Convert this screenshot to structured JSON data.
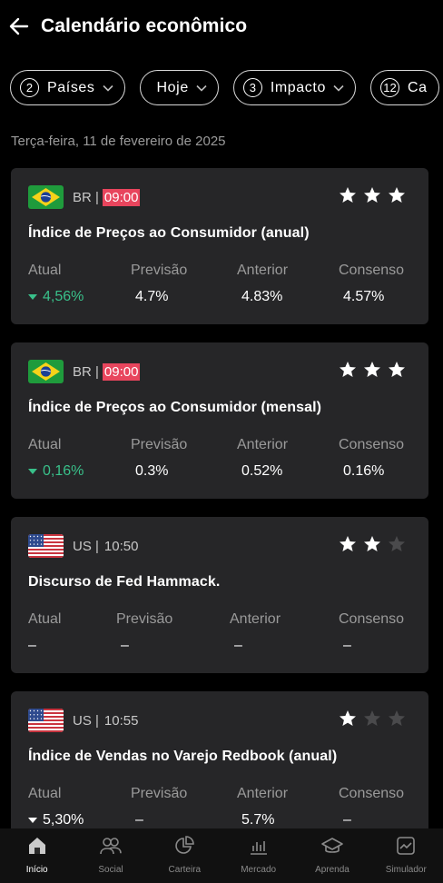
{
  "header": {
    "title": "Calendário econômico"
  },
  "filters": [
    {
      "badge": "2",
      "label": "Países",
      "chevron": true
    },
    {
      "badge": "",
      "label": "Hoje",
      "chevron": true
    },
    {
      "badge": "3",
      "label": "Impacto",
      "chevron": true
    },
    {
      "badge": "12",
      "label": "Ca",
      "chevron": false
    }
  ],
  "date_label": "Terça-feira, 11 de fevereiro de 2025",
  "events": [
    {
      "flag": "br-flag",
      "country": "BR |",
      "time": "09:00",
      "time_highlight": true,
      "stars": 3,
      "title": "Índice de Preços ao Consumidor (anual)",
      "labels": [
        "Atual",
        "Previsão",
        "Anterior",
        "Consenso"
      ],
      "values": [
        "4,56%",
        "4.7%",
        "4.83%",
        "4.57%"
      ],
      "actual_trend": "down",
      "actual_color": "#39c08a"
    },
    {
      "flag": "br-flag",
      "country": "BR |",
      "time": "09:00",
      "time_highlight": true,
      "stars": 3,
      "title": "Índice de Preços ao Consumidor (mensal)",
      "labels": [
        "Atual",
        "Previsão",
        "Anterior",
        "Consenso"
      ],
      "values": [
        "0,16%",
        "0.3%",
        "0.52%",
        "0.16%"
      ],
      "actual_trend": "down",
      "actual_color": "#39c08a"
    },
    {
      "flag": "us-flag",
      "country": "US |",
      "time": "10:50",
      "time_highlight": false,
      "stars": 2,
      "title": "Discurso de Fed Hammack.",
      "labels": [
        "Atual",
        "Previsão",
        "Anterior",
        "Consenso"
      ],
      "values": [
        "–",
        "–",
        "–",
        "–"
      ],
      "actual_trend": "none",
      "actual_color": "#ffffff"
    },
    {
      "flag": "us-flag",
      "country": "US |",
      "time": "10:55",
      "time_highlight": false,
      "stars": 1,
      "title": "Índice de Vendas no Varejo Redbook (anual)",
      "labels": [
        "Atual",
        "Previsão",
        "Anterior",
        "Consenso"
      ],
      "values": [
        "5,30%",
        "–",
        "5.7%",
        "–"
      ],
      "actual_trend": "down",
      "actual_color": "#ffffff"
    }
  ],
  "nav": [
    {
      "label": "Início",
      "icon": "home-icon",
      "active": true
    },
    {
      "label": "Social",
      "icon": "social-icon",
      "active": false
    },
    {
      "label": "Carteira",
      "icon": "pie-chart-icon",
      "active": false
    },
    {
      "label": "Mercado",
      "icon": "bar-chart-icon",
      "active": false
    },
    {
      "label": "Aprenda",
      "icon": "graduation-cap-icon",
      "active": false
    },
    {
      "label": "Simulador",
      "icon": "simulator-icon",
      "active": false
    }
  ],
  "colors": {
    "highlight_time": "#e8455d",
    "positive": "#39c08a",
    "star_on": "#ffffff",
    "star_off": "#4a4a4c",
    "card": "#262628"
  }
}
